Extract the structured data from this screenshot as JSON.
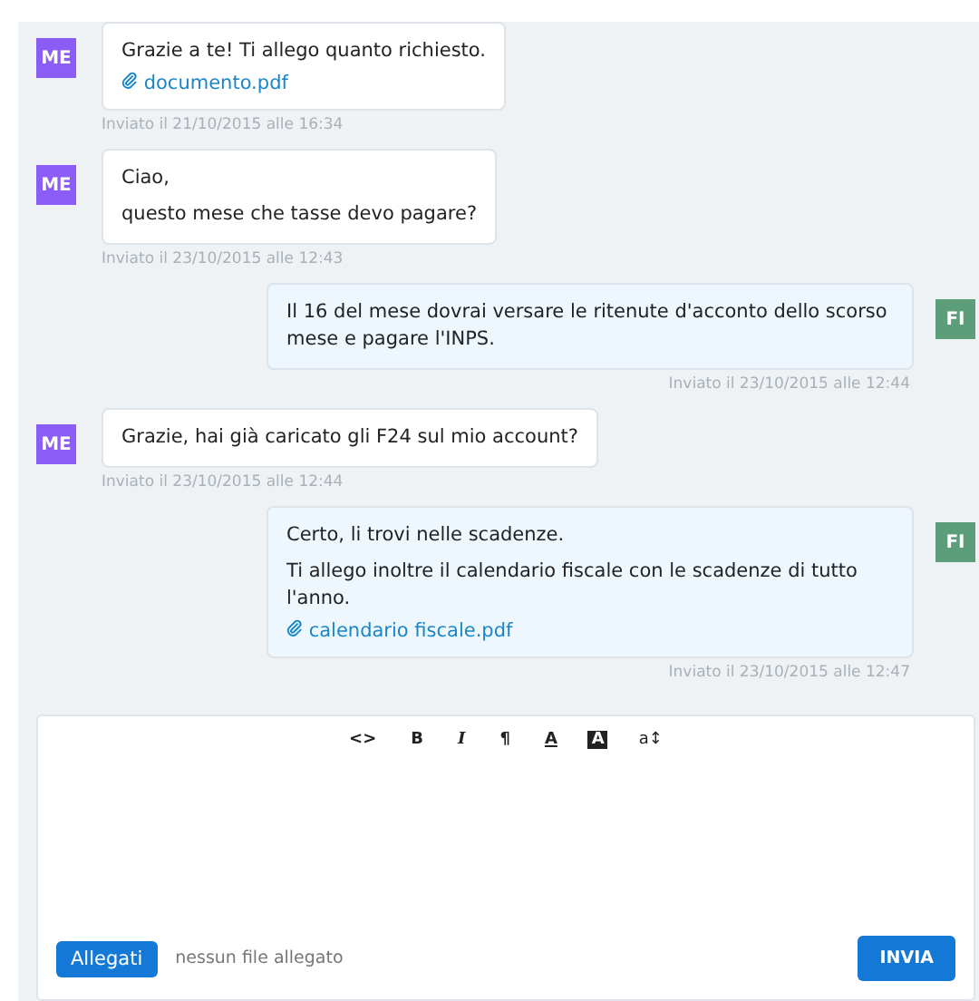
{
  "messages": [
    {
      "sender": "ME",
      "kind": "incoming",
      "paragraphs": [
        "Grazie a te! Ti allego quanto richiesto."
      ],
      "attachment": "documento.pdf",
      "timestamp": "Inviato il 21/10/2015 alle 16:34"
    },
    {
      "sender": "ME",
      "kind": "incoming",
      "paragraphs": [
        "Ciao,",
        "questo mese che tasse devo pagare?"
      ],
      "timestamp": "Inviato il 23/10/2015 alle 12:43"
    },
    {
      "sender": "FI",
      "kind": "outgoing",
      "paragraphs": [
        "Il 16 del mese dovrai versare le ritenute d'acconto dello scorso mese e pagare l'INPS."
      ],
      "timestamp": "Inviato il 23/10/2015 alle 12:44"
    },
    {
      "sender": "ME",
      "kind": "incoming",
      "paragraphs": [
        "Grazie, hai già caricato gli F24 sul mio account?"
      ],
      "timestamp": "Inviato il 23/10/2015 alle 12:44"
    },
    {
      "sender": "FI",
      "kind": "outgoing",
      "paragraphs": [
        "Certo, li trovi nelle scadenze.",
        "Ti allego inoltre il calendario fiscale con le scadenze di tutto l'anno."
      ],
      "attachment": "calendario fiscale.pdf",
      "timestamp": "Inviato il 23/10/2015 alle 12:47"
    }
  ],
  "editor": {
    "toolbar": [
      {
        "kind": "code",
        "glyph": "<>"
      },
      {
        "kind": "bold",
        "glyph": "B"
      },
      {
        "kind": "italic",
        "glyph": "I"
      },
      {
        "kind": "paragraph",
        "glyph": "¶"
      },
      {
        "kind": "underline",
        "glyph": "A"
      },
      {
        "kind": "inverse",
        "glyph": "A"
      },
      {
        "kind": "size",
        "glyph": "a↕"
      }
    ],
    "attach_button": "Allegati",
    "attach_status": "nessun file allegato",
    "send_button": "INVIA"
  }
}
